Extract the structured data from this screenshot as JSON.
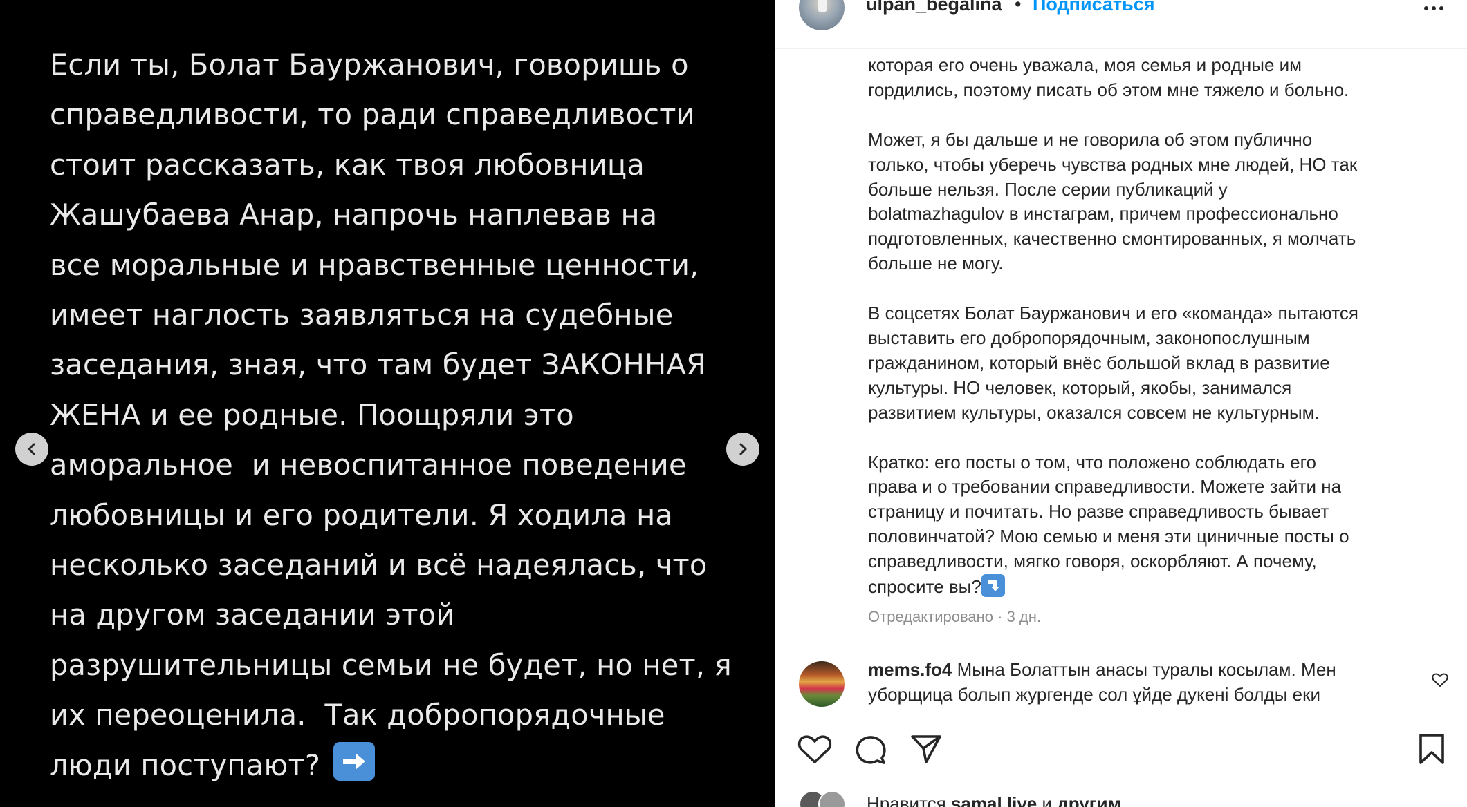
{
  "media": {
    "slide_text": "Если ты, Болат Бауржанович, говоришь о\nсправедливости, то ради справедливости\nстоит рассказать, как твоя любовница\nЖашубаева Анар, напрочь наплевав на\nвсе моральные и нравственные ценности,\nимеет наглость заявляться на судебные\nзаседания, зная, что там будет ЗАКОННАЯ\nЖЕНА и ее родные. Поощряли это\nаморальное  и невоспитанное поведение\nлюбовницы и его родители. Я ходила на\nнесколько заседаний и всё надеялась, что\nна другом заседании этой\nразрушительницы семьи не будет, но нет, я\nих переоценила.  Так добропорядочные\nлюди поступают? ",
    "slide_emoji": "right-arrow-emoji",
    "prev_icon": "chevron-left-icon",
    "next_icon": "chevron-right-icon"
  },
  "header": {
    "username": "ulpan_begalina",
    "separator": "•",
    "follow_label": "Подписаться",
    "more_icon": "more-horizontal-icon"
  },
  "caption": {
    "text": "которая его очень уважала, моя семья и родные им\nгордились, поэтому писать об этом мне тяжело и больно.\n\nМожет, я бы дальше и не говорила об этом публично\nтолько, чтобы уберечь чувства родных мне людей, НО так\nбольше нельзя. После серии публикаций у\nbolatmazhagulov в инстаграм, причем профессионально\nподготовленных, качественно смонтированных, я молчать\nбольше не могу.\n\nВ соцсетях Болат Бауржанович и его «команда» пытаются\nвыставить его добропорядочным, законопослушным\nгражданином, который внёс большой вклад в развитие\nкультуры. НО человек, который, якобы, занимался\nразвитием культуры, оказался совсем не культурным.\n\nКратко: его посты о том, что положено соблюдать его\nправа и о требовании справедливости. Можете зайти на\nстраницу и почитать. Но разве справедливость бывает\nполовинчатой? Мою семью и меня эти циничные посты о\nсправедливости, мягко говоря, оскорбляют. А почему,\nспросите вы?",
    "end_emoji": "down-arrow-emoji",
    "edited": "Отредактировано · 3 дн."
  },
  "comment": {
    "username": "mems.fo4",
    "text": " Мына Болаттын анасы туралы косылам. Мен\nуборщица болып жургенде сол ұйде дукені болды еки"
  },
  "actions": {
    "like_icon": "heart-icon",
    "comment_icon": "comment-icon",
    "share_icon": "send-icon",
    "save_icon": "bookmark-icon"
  },
  "likes": {
    "prefix": "Нравится ",
    "user": "samal.live",
    "middle": " и ",
    "others": "другим"
  },
  "colors": {
    "accent": "#0095f6",
    "media_bg": "#000000",
    "emoji_blue": "#4a90d9"
  }
}
